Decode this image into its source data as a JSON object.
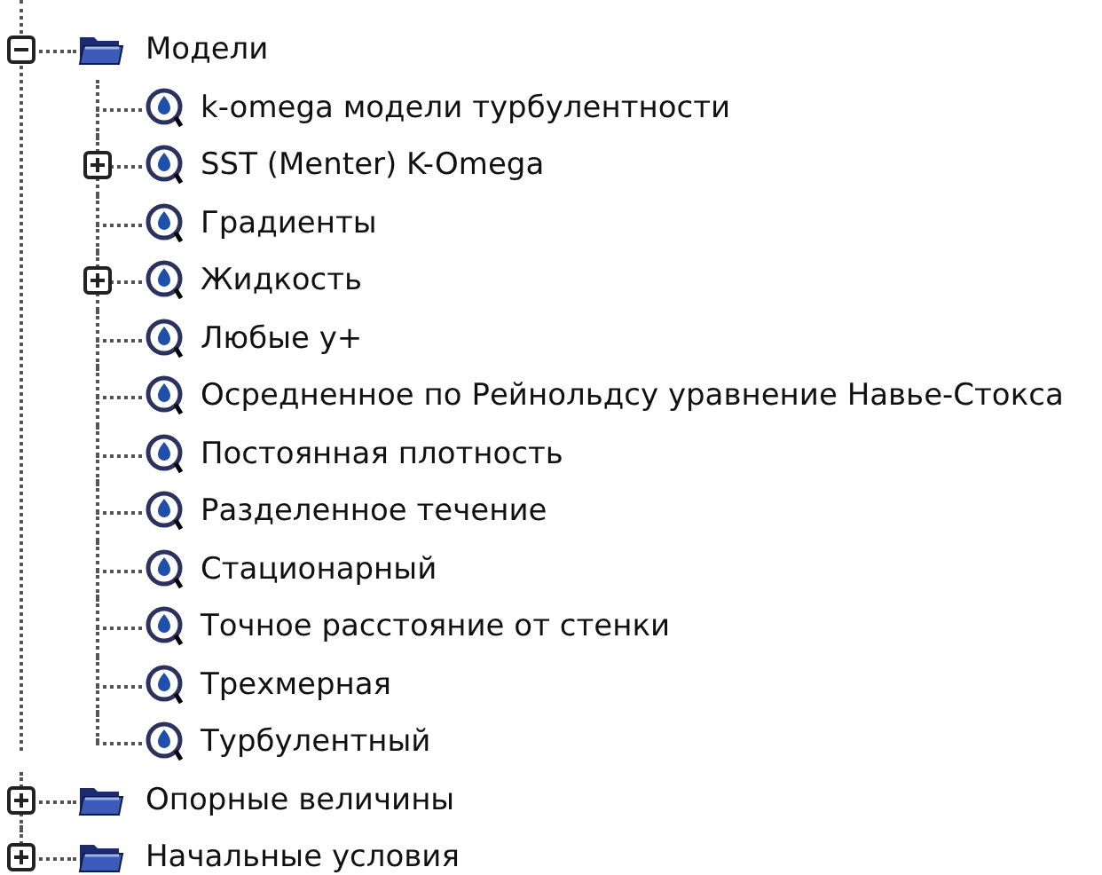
{
  "tree": [
    {
      "kind": "folder",
      "label": "Модели",
      "expanded": true,
      "children": [
        {
          "kind": "model",
          "label": "k-omega модели турбулентности"
        },
        {
          "kind": "model",
          "label": "SST (Menter) K-Omega",
          "expanded": false
        },
        {
          "kind": "model",
          "label": "Градиенты"
        },
        {
          "kind": "model",
          "label": "Жидкость",
          "expanded": false
        },
        {
          "kind": "model",
          "label": "Любые y+"
        },
        {
          "kind": "model",
          "label": "Осредненное по Рейнольдсу уравнение Навье-Стокса"
        },
        {
          "kind": "model",
          "label": "Постоянная плотность"
        },
        {
          "kind": "model",
          "label": "Разделенное течение"
        },
        {
          "kind": "model",
          "label": "Стационарный"
        },
        {
          "kind": "model",
          "label": "Точное расстояние от стенки"
        },
        {
          "kind": "model",
          "label": "Трехмерная"
        },
        {
          "kind": "model",
          "label": "Турбулентный"
        }
      ]
    },
    {
      "kind": "folder",
      "label": "Опорные величины",
      "expanded": false
    },
    {
      "kind": "folder",
      "label": "Начальные условия",
      "expanded": false
    }
  ]
}
